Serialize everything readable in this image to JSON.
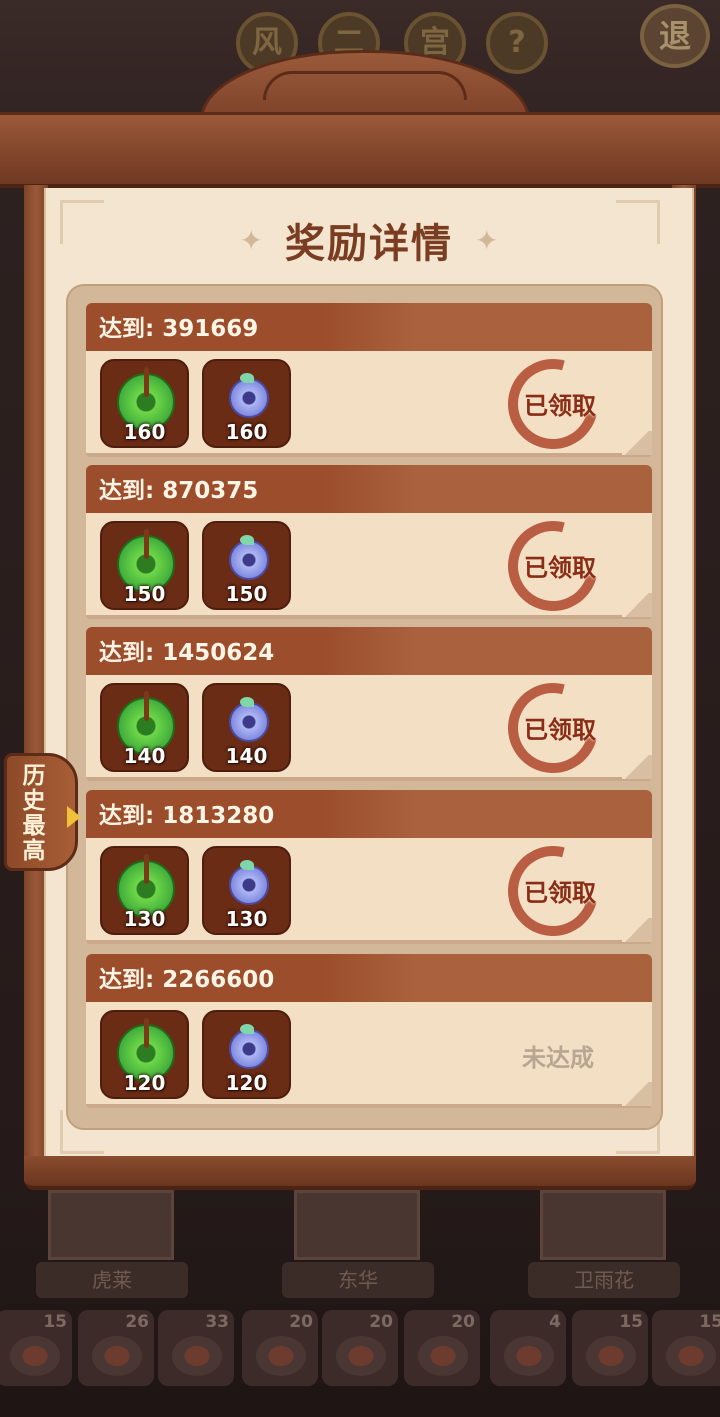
{
  "top_bar": {
    "buttons": [
      "风",
      "二",
      "宫",
      "?"
    ],
    "exit_label": "退"
  },
  "dialog": {
    "title": "奖励详情"
  },
  "rewards": [
    {
      "label": "达到: 391669",
      "items": [
        {
          "icon": "jade-icon",
          "qty": "160"
        },
        {
          "icon": "coin-icon",
          "qty": "160"
        }
      ],
      "status": "已领取",
      "claimed": true
    },
    {
      "label": "达到: 870375",
      "items": [
        {
          "icon": "jade-icon",
          "qty": "150"
        },
        {
          "icon": "coin-icon",
          "qty": "150"
        }
      ],
      "status": "已领取",
      "claimed": true
    },
    {
      "label": "达到: 1450624",
      "items": [
        {
          "icon": "jade-icon",
          "qty": "140"
        },
        {
          "icon": "coin-icon",
          "qty": "140"
        }
      ],
      "status": "已领取",
      "claimed": true
    },
    {
      "label": "达到: 1813280",
      "items": [
        {
          "icon": "jade-icon",
          "qty": "130"
        },
        {
          "icon": "coin-icon",
          "qty": "130"
        }
      ],
      "status": "已领取",
      "claimed": true
    },
    {
      "label": "达到: 2266600",
      "items": [
        {
          "icon": "jade-icon",
          "qty": "120"
        },
        {
          "icon": "coin-icon",
          "qty": "120"
        }
      ],
      "status": "未达成",
      "claimed": false
    }
  ],
  "history_tab": {
    "label": "历史最高"
  },
  "characters": [
    "虎莱",
    "东华",
    "卫雨花"
  ],
  "dishes": [
    "15",
    "26",
    "33",
    "20",
    "20",
    "20",
    "4",
    "15",
    "15"
  ],
  "colors": {
    "wood": "#9c4e2c",
    "paper": "#f3e5cf",
    "claimed_stamp": "#b0482c",
    "pending_text": "#b8a592"
  }
}
